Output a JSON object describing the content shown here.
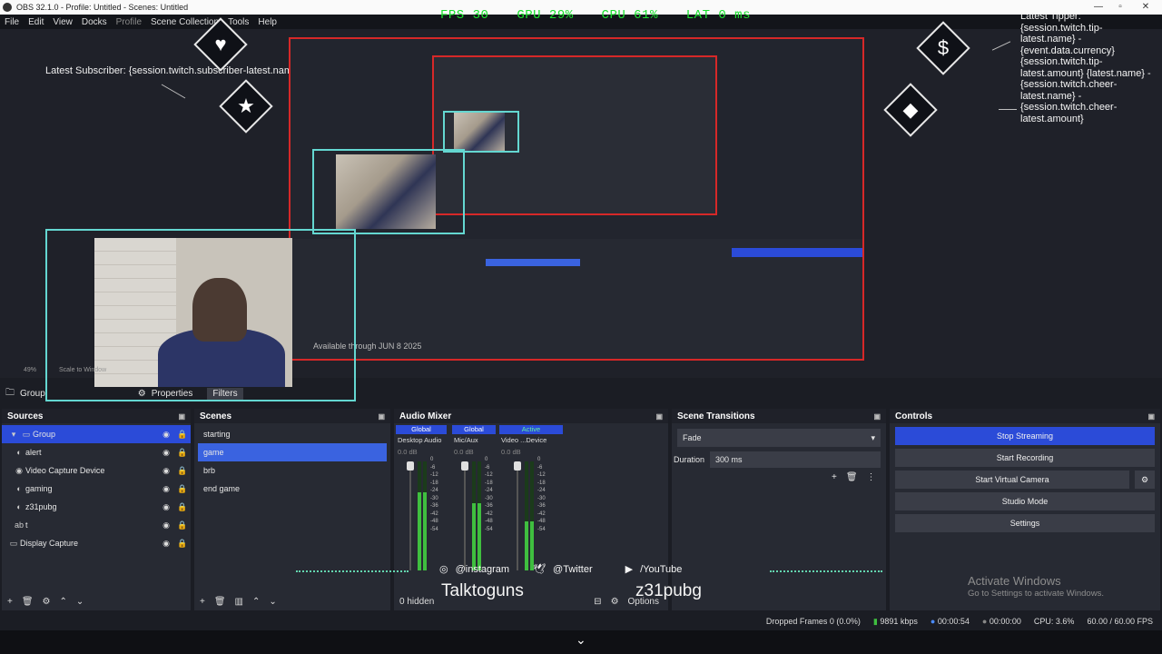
{
  "window": {
    "title": "OBS 32.1.0 - Profile: Untitled - Scenes: Untitled"
  },
  "menu": [
    "File",
    "Edit",
    "View",
    "Docks",
    "Profile",
    "Scene Collection",
    "Tools",
    "Help"
  ],
  "overlay": {
    "stats": {
      "fps": "FPS 30",
      "gpu": "GPU 29%",
      "cpu": "CPU 61%",
      "lat": "LAT 0 ms"
    },
    "latest_subscriber": "Latest Subscriber: {session.twitch.subscriber-latest.name}",
    "tipper": "Latest Tipper: {session.twitch.tip-latest.name} - {event.data.currency} {session.twitch.tip-latest.amount} {latest.name} - {session.twitch.cheer-latest.name} - {session.twitch.cheer-latest.amount}",
    "icons": {
      "heart": "♥",
      "star": "★",
      "dollar": "$",
      "diamond": "◆"
    },
    "social": {
      "instagram": "@instagram",
      "twitter": "@Twitter",
      "youtube": "/YouTube"
    },
    "names": {
      "left": "Talktoguns",
      "right": "z31pubg"
    },
    "available": "Available through JUN 8 2025"
  },
  "preview": {
    "zoom": "49%",
    "scale": "Scale to Window"
  },
  "group_bar": {
    "name": "Group",
    "properties": "Properties",
    "filters": "Filters"
  },
  "sources": {
    "title": "Sources",
    "items": [
      {
        "icon": "▾ ▭",
        "label": "Group",
        "selected": true
      },
      {
        "icon": "◐",
        "label": "alert"
      },
      {
        "icon": "◉",
        "label": "Video Capture Device"
      },
      {
        "icon": "◐",
        "label": "gaming"
      },
      {
        "icon": "◐",
        "label": "z31pubg"
      },
      {
        "icon": "ab",
        "label": "t"
      },
      {
        "icon": "▭",
        "label": "Display Capture"
      }
    ]
  },
  "scenes": {
    "title": "Scenes",
    "items": [
      {
        "label": "starting"
      },
      {
        "label": "game",
        "selected": true
      },
      {
        "label": "brb"
      },
      {
        "label": "end game"
      }
    ]
  },
  "mixer": {
    "title": "Audio Mixer",
    "channels": [
      {
        "tag": "Global",
        "name": "Desktop Audio",
        "db": "0.0 dB",
        "level": 0.72
      },
      {
        "tag": "Global",
        "name": "Mic/Aux",
        "db": "0.0 dB",
        "level": 0.62
      },
      {
        "tag": "Active",
        "name": "Video ...Device",
        "db": "0.0 dB",
        "level": 0.45
      }
    ],
    "scale": [
      "0",
      "-6",
      "-12",
      "-18",
      "-24",
      "-30",
      "-36",
      "-42",
      "-48",
      "-54"
    ],
    "hidden": "0 hidden",
    "options": "Options"
  },
  "transitions": {
    "title": "Scene Transitions",
    "selected": "Fade",
    "duration_label": "Duration",
    "duration_value": "300 ms"
  },
  "controls": {
    "title": "Controls",
    "buttons": [
      "Stop Streaming",
      "Start Recording",
      "Start Virtual Camera",
      "Studio Mode",
      "Settings"
    ]
  },
  "watermark": {
    "line1": "Activate Windows",
    "line2": "Go to Settings to activate Windows."
  },
  "status": {
    "dropped": "Dropped Frames 0 (0.0%)",
    "kbps": "9891 kbps",
    "stream_time": "00:00:54",
    "rec_time": "00:00:00",
    "cpu": "CPU: 3.6%",
    "fps": "60.00 / 60.00 FPS"
  },
  "colors": {
    "accent": "#2b4bd8",
    "overlay_green": "#19e02d",
    "selection_red": "#d62828",
    "teal": "#64d7d1"
  }
}
